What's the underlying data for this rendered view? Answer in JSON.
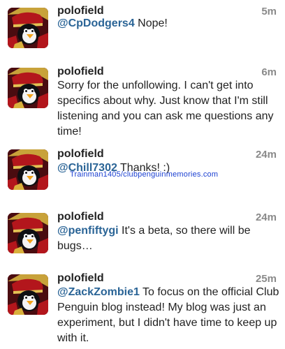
{
  "tweets": [
    {
      "username": "polofield",
      "time": "5m",
      "mention": "@CpDodgers4",
      "text": " Nope!",
      "avatar_icon": "penguin-avatar-icon"
    },
    {
      "username": "polofield",
      "time": "6m",
      "mention": "",
      "text": "Sorry for the unfollowing. I can't get into specifics about why. Just know that I'm still listening and you can ask me questions any time!",
      "avatar_icon": "penguin-avatar-icon"
    },
    {
      "username": "polofield",
      "time": "24m",
      "mention": "@Chill7302",
      "text": " Thanks! :)",
      "avatar_icon": "penguin-avatar-icon"
    },
    {
      "username": "polofield",
      "time": "24m",
      "mention": "@penfiftygi",
      "text": " It's a beta, so there will be bugs…",
      "avatar_icon": "penguin-avatar-icon"
    },
    {
      "username": "polofield",
      "time": "25m",
      "mention": "@ZackZombie1",
      "text": " To focus on the official Club Penguin blog instead! My blog was just an experiment, but I didn't have time to keep up with it.",
      "avatar_icon": "penguin-avatar-icon"
    }
  ],
  "watermark": "Trainman1405/clubpenguinmemories.com",
  "colors": {
    "mention": "#2a6496",
    "timestamp": "#8a8a8a",
    "divider": "#d9d9d9",
    "watermark": "#1a3fd1"
  }
}
